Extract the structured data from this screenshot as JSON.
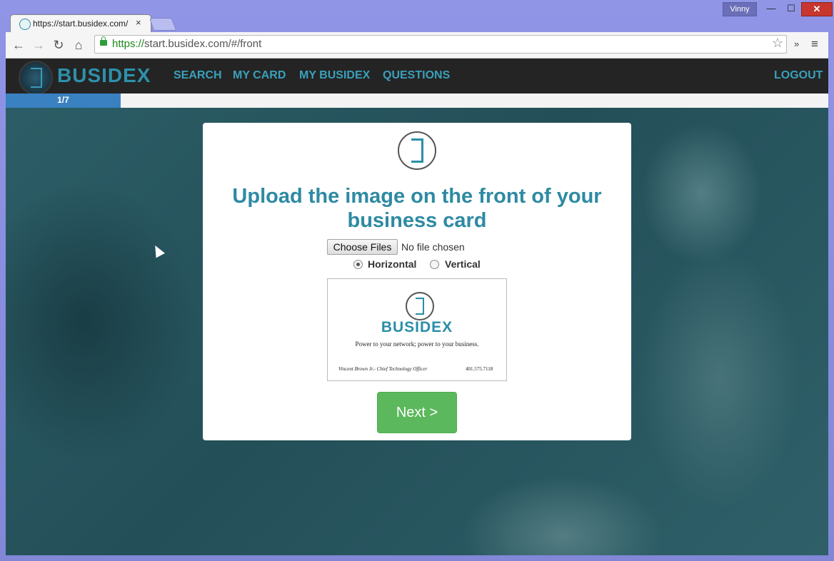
{
  "window": {
    "user_badge": "Vinny",
    "minimize_glyph": "—",
    "maximize_glyph": "☐",
    "close_glyph": "✕"
  },
  "tab": {
    "title": "https://start.busidex.com/",
    "close_glyph": "×"
  },
  "toolbar": {
    "back_glyph": "←",
    "forward_glyph": "→",
    "reload_glyph": "↻",
    "home_glyph": "⌂",
    "url_scheme": "https://",
    "url_rest": "start.busidex.com/#/front",
    "star_glyph": "☆",
    "extensions_glyph": "»",
    "menu_glyph": "≡"
  },
  "navbar": {
    "brand": "BUSIDEX",
    "links": [
      "SEARCH",
      "MY CARD",
      "MY BUSIDEX",
      "QUESTIONS"
    ],
    "logout": "LOGOUT"
  },
  "progress": {
    "label": "1/7",
    "fraction": 0.14
  },
  "card": {
    "heading": "Upload the image on the front of your business card",
    "file_button": "Choose Files",
    "file_status": "No file chosen",
    "orientation": {
      "horizontal": "Horizontal",
      "vertical": "Vertical",
      "selected": "Horizontal"
    },
    "preview": {
      "brand": "BUSIDEX",
      "tagline": "Power to your network; power to your business.",
      "person": "Vincent Brown Jr.- Chief Technology Officer",
      "phone": "401.575.7118"
    },
    "next_button": "Next >"
  },
  "colors": {
    "brand_teal": "#2e8aa3",
    "nav_bg": "#242424",
    "progress_blue": "#3a81c1",
    "next_green": "#5cb85c"
  }
}
